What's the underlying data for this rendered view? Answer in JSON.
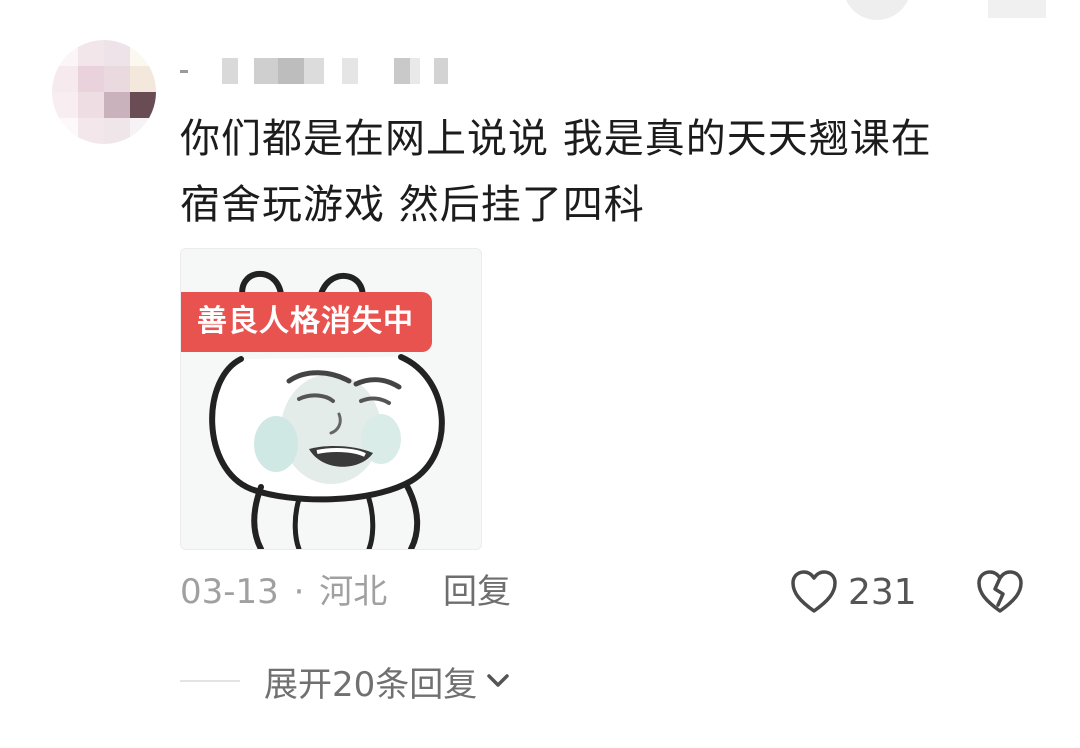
{
  "comment": {
    "text": "你们都是在网上说说 我是真的天天翘课在宿舍玩游戏 然后挂了四科",
    "line1": "你们都是在网上说说 我是真的天天翘课在",
    "line2": "宿舍玩游戏 然后挂了四科",
    "sticker": {
      "caption": "善良人格消失中"
    },
    "date": "03-13",
    "separator": "·",
    "location": "河北",
    "reply_label": "回复",
    "likes": "231",
    "expand_label": "展开20条回复"
  },
  "icons": {
    "like": "heart-icon",
    "dislike": "broken-heart-icon",
    "expand": "chevron-down-icon"
  },
  "colors": {
    "tag_red": "#e8524f",
    "meta_gray": "#a0a0a0"
  }
}
